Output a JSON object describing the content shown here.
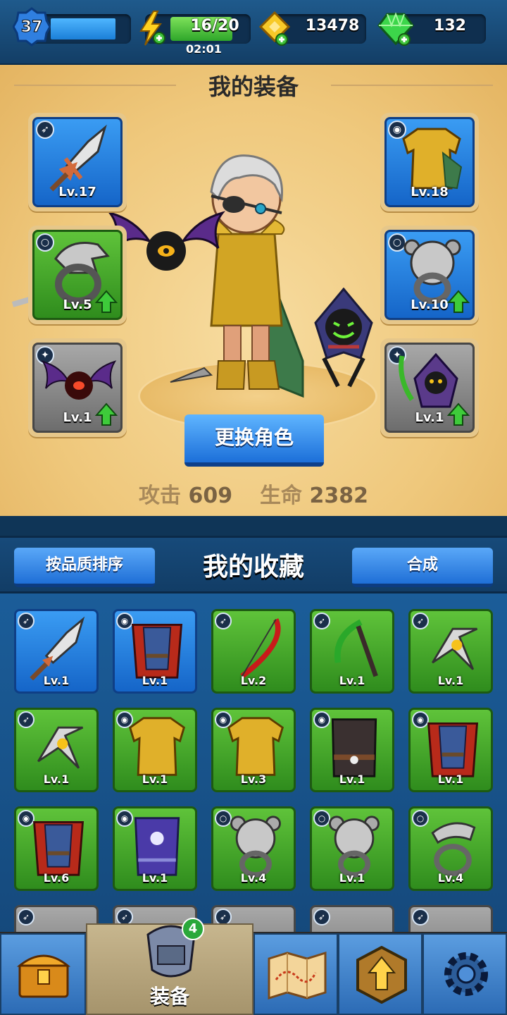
{
  "topbar": {
    "player_level": "37",
    "energy": "16/20",
    "energy_fraction": 0.8,
    "timer": "02:01",
    "gold": "13478",
    "gems": "132"
  },
  "equipment": {
    "title": "我的装备",
    "slots": [
      {
        "type_icon": "bow-icon",
        "item": "sword",
        "level": "Lv.17",
        "rarity": "blue",
        "upgrade": false
      },
      {
        "type_icon": "armor-icon",
        "item": "gold-armor",
        "level": "Lv.18",
        "rarity": "blue",
        "upgrade": false
      },
      {
        "type_icon": "ring-icon",
        "item": "eagle-ring",
        "level": "Lv.5",
        "rarity": "green",
        "upgrade": true
      },
      {
        "type_icon": "ring-icon",
        "item": "bear-ring",
        "level": "Lv.10",
        "rarity": "blue",
        "upgrade": true
      },
      {
        "type_icon": "paw-icon",
        "item": "bat-pet",
        "level": "Lv.1",
        "rarity": "grey",
        "upgrade": true
      },
      {
        "type_icon": "paw-icon",
        "item": "reaper-pet",
        "level": "Lv.1",
        "rarity": "grey",
        "upgrade": true
      }
    ],
    "change_button": "更换角色",
    "attack_label": "攻击",
    "attack_value": "609",
    "hp_label": "生命",
    "hp_value": "2382"
  },
  "collection": {
    "sort_button": "按品质排序",
    "title": "我的收藏",
    "merge_button": "合成",
    "items": [
      {
        "type_icon": "bow-icon",
        "item": "sword",
        "level": "Lv.1",
        "rarity": "blue"
      },
      {
        "type_icon": "armor-icon",
        "item": "red-cape-armor",
        "level": "Lv.1",
        "rarity": "blue"
      },
      {
        "type_icon": "bow-icon",
        "item": "red-bow",
        "level": "Lv.2",
        "rarity": "green"
      },
      {
        "type_icon": "bow-icon",
        "item": "scythe",
        "level": "Lv.1",
        "rarity": "green"
      },
      {
        "type_icon": "bow-icon",
        "item": "boomerang",
        "level": "Lv.1",
        "rarity": "green"
      },
      {
        "type_icon": "bow-icon",
        "item": "boomerang",
        "level": "Lv.1",
        "rarity": "green"
      },
      {
        "type_icon": "armor-icon",
        "item": "gold-armor",
        "level": "Lv.1",
        "rarity": "green"
      },
      {
        "type_icon": "armor-icon",
        "item": "gold-armor",
        "level": "Lv.3",
        "rarity": "green"
      },
      {
        "type_icon": "armor-icon",
        "item": "dark-vest",
        "level": "Lv.1",
        "rarity": "green"
      },
      {
        "type_icon": "armor-icon",
        "item": "red-cape-armor",
        "level": "Lv.1",
        "rarity": "green"
      },
      {
        "type_icon": "armor-icon",
        "item": "red-cape-armor",
        "level": "Lv.6",
        "rarity": "green"
      },
      {
        "type_icon": "armor-icon",
        "item": "purple-robe",
        "level": "Lv.1",
        "rarity": "green"
      },
      {
        "type_icon": "ring-icon",
        "item": "bear-ring",
        "level": "Lv.4",
        "rarity": "green"
      },
      {
        "type_icon": "ring-icon",
        "item": "bear-ring",
        "level": "Lv.1",
        "rarity": "green"
      },
      {
        "type_icon": "ring-icon",
        "item": "snake-ring",
        "level": "Lv.4",
        "rarity": "green"
      }
    ]
  },
  "nav": {
    "equip_label": "装备",
    "equip_badge": "4"
  }
}
